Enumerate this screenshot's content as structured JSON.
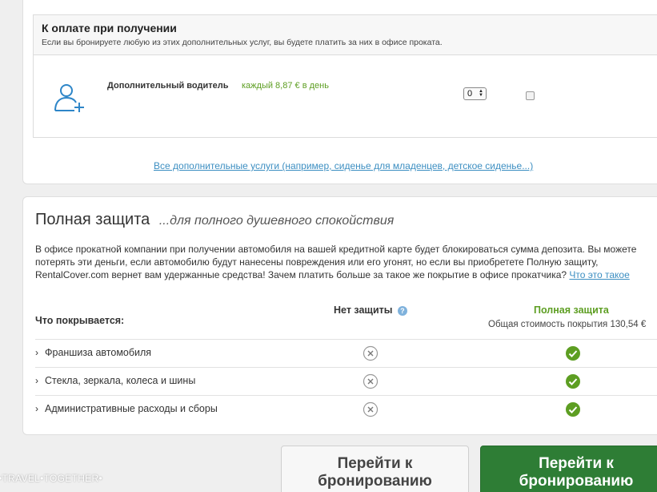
{
  "extras": {
    "pay_title": "К оплате при получении",
    "pay_note": "Если вы бронируете любую из этих дополнительных услуг, вы будете платить за них в офисе проката.",
    "driver_label": "Дополнительный водитель",
    "driver_price": "каждый 8,87 € в день",
    "quantity_value": "0",
    "all_services_link": "Все дополнительные услуги (например, сиденье для младенцев, детское сиденье...)"
  },
  "protection": {
    "title": "Полная защита",
    "subtitle": "...для полного душевного спокойствия",
    "text": "В офисе прокатной компании при получении автомобиля на вашей кредитной карте будет блокироваться сумма депозита. Вы можете потерять эти деньги, если автомобилю будут нанесены повреждения или его угонят, но если вы приобретете Полную защиту, RentalCover.com вернет вам удержанные средства! Зачем платить больше за такое же покрытие в офисе прокатчика?",
    "link": "Что это такое",
    "col_covered": "Что покрывается:",
    "col_none": "Нет защиты",
    "col_full": "Полная защита",
    "col_total": "Общая стоимость покрытия 130,54 €",
    "rows": [
      {
        "label": "Франшиза автомобиля"
      },
      {
        "label": "Стекла, зеркала, колеса и шины"
      },
      {
        "label": "Административные расходы и сборы"
      }
    ]
  },
  "buttons": {
    "continue_gray": "Перейти к бронированию",
    "continue_green": "Перейти к бронированию"
  },
  "watermark": "•TRAVEL•TOGETHER•",
  "colors": {
    "accent_green": "#5d9e22",
    "button_green": "#2e7d35",
    "link_blue": "#3d8fc2"
  }
}
